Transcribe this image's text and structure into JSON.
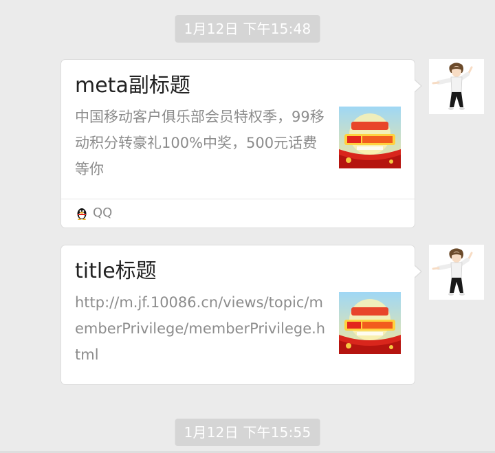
{
  "chat": {
    "timestamps": [
      "1月12日 下午15:48",
      "1月12日 下午15:55"
    ],
    "messages": [
      {
        "title": "meta副标题",
        "description": "中国移动客户俱乐部会员特权季，99移动积分转豪礼100%中奖，500元话费等你",
        "source": "QQ",
        "thumbnail_icon": "promo-thumbnail"
      },
      {
        "title": "title标题",
        "description": "http://m.jf.10086.cn/views/topic/memberPrivilege/memberPrivilege.html",
        "thumbnail_icon": "promo-thumbnail"
      }
    ],
    "avatar_icon": "boy-avatar-icon"
  },
  "colors": {
    "background": "#ebebeb",
    "timestamp_bg": "#d5d5d5",
    "card_bg": "#ffffff",
    "title": "#222222",
    "description": "#8c8c8c"
  }
}
